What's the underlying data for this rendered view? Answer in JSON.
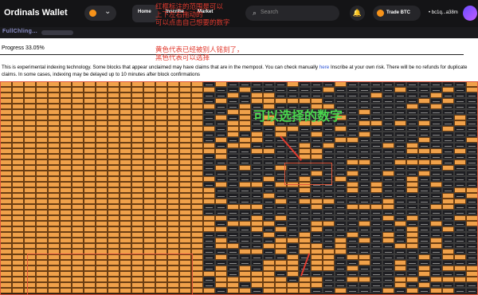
{
  "header": {
    "app_title": "Ordinals Wallet",
    "nav": [
      "Home",
      "Inscribe",
      "Market"
    ],
    "search_placeholder": "Search",
    "trade_label": "Trade BTC",
    "account": "• bc1q...a38m",
    "sub_name": "FullChling..."
  },
  "progress_text": "Progress 33.05%",
  "notice": {
    "before": "This is experimental indexing technology. Some blocks that appear unclaimed may have claims that are in the mempool. You can check manually ",
    "link": "here",
    "after": " Inscribe at your own risk. There will be no refunds for duplicate claims. In some cases, indexing may be delayed up to 10 minutes after block confirmations"
  },
  "annotations": {
    "top": "红框标注的范围是可以\n上下左右拖动的\n可以点击自己想要的数字",
    "colors": "黄色代表已经被别人铭刻了，\n黑色代表可以选择",
    "selectable": "可以选择的数字"
  },
  "colors": {
    "claimed": "#f0a14a",
    "available": "#1e1e22",
    "annotation": "#e23a2e",
    "green_note": "#49d64d"
  }
}
